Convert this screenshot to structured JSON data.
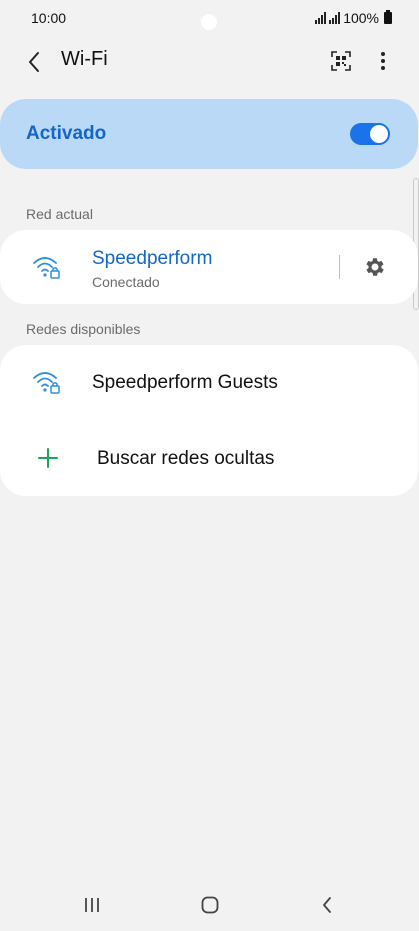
{
  "status_bar": {
    "time": "10:00",
    "battery_text": "100%"
  },
  "header": {
    "title": "Wi-Fi",
    "back_icon": "chevron-left-icon",
    "qr_icon": "qr-scan-icon",
    "more_icon": "more-vert-icon"
  },
  "wifi_toggle": {
    "label": "Activado",
    "state": "on",
    "accent_color": "#1a73e8",
    "card_color": "#b9d9f7"
  },
  "current_network": {
    "section_label": "Red actual",
    "name": "Speedperform",
    "status": "Conectado",
    "icon": "wifi-lock-icon",
    "settings_icon": "gear-icon"
  },
  "available_networks": {
    "section_label": "Redes disponibles",
    "items": [
      {
        "name": "Speedperform Guests",
        "icon": "wifi-lock-icon"
      }
    ],
    "add_hidden_label": "Buscar redes ocultas",
    "add_icon": "plus-icon"
  },
  "nav_bar": {
    "recents_icon": "recents-icon",
    "home_icon": "home-icon",
    "back_icon": "back-icon"
  }
}
